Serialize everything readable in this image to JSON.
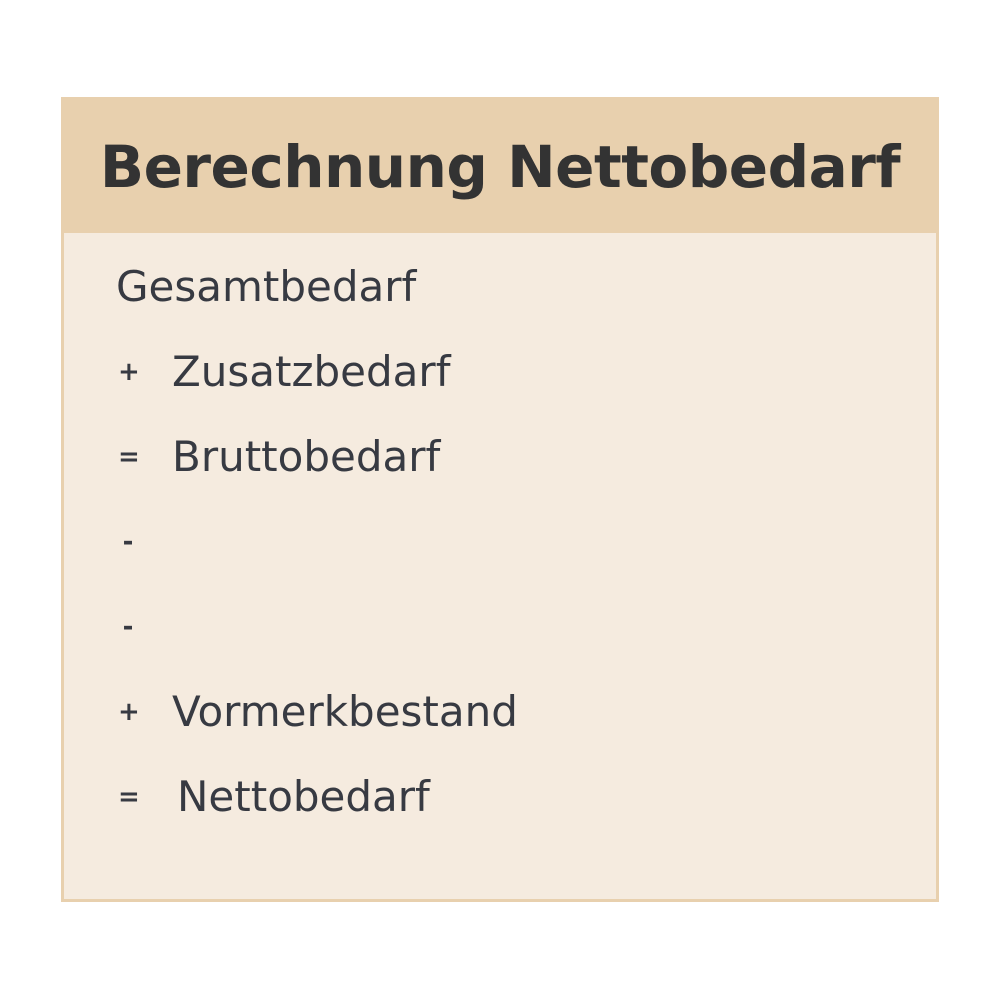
{
  "title": "Berechnung Nettobedarf",
  "rows": [
    {
      "op": "",
      "label": "Gesamtbedarf"
    },
    {
      "op": "+",
      "label": "Zusatzbedarf"
    },
    {
      "op": "=",
      "label": "Bruttobedarf"
    },
    {
      "op": "-",
      "label": ""
    },
    {
      "op": "-",
      "label": ""
    },
    {
      "op": "+",
      "label": "Vormerkbestand"
    },
    {
      "op": "=",
      "label": "Nettobedarf"
    }
  ]
}
